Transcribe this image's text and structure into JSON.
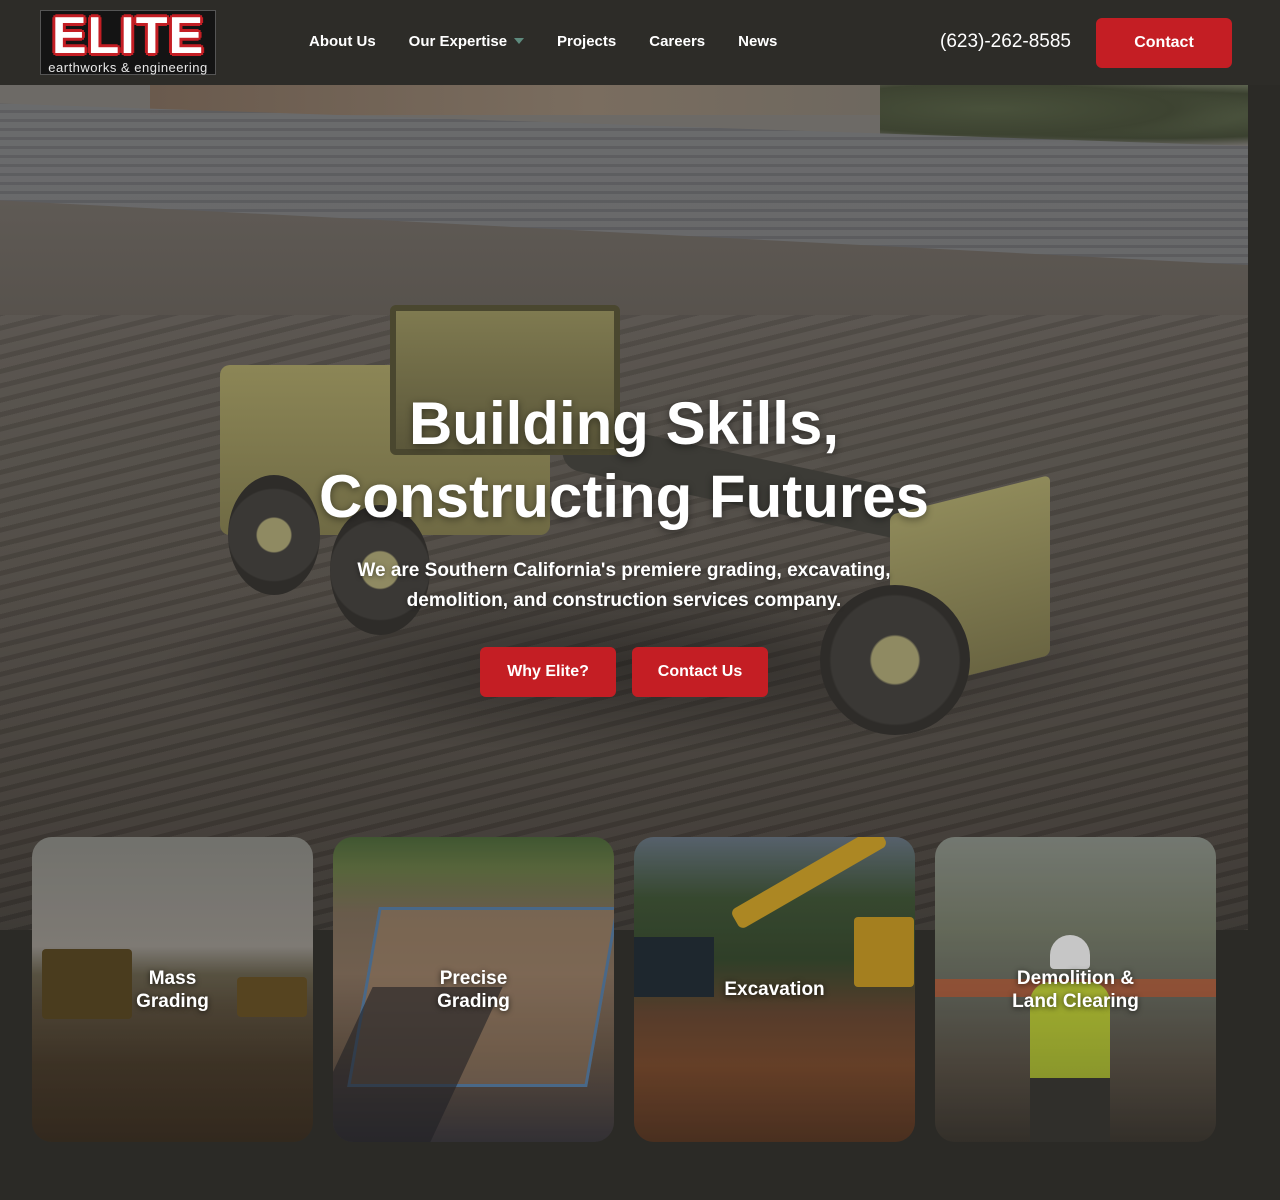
{
  "brand": {
    "logo_text": "ELITE",
    "logo_tagline": "earthworks & engineering",
    "accent_color": "#c41e24"
  },
  "nav": {
    "items": [
      {
        "label": "About Us",
        "has_dropdown": false
      },
      {
        "label": "Our Expertise",
        "has_dropdown": true
      },
      {
        "label": "Projects",
        "has_dropdown": false
      },
      {
        "label": "Careers",
        "has_dropdown": false
      },
      {
        "label": "News",
        "has_dropdown": false
      }
    ],
    "phone": "(623)-262-8585",
    "contact_label": "Contact"
  },
  "hero": {
    "title_line1": "Building Skills,",
    "title_line2": "Constructing Futures",
    "subtitle_line1": "We are Southern California's premiere grading, excavating,",
    "subtitle_line2": "demolition, and construction services company.",
    "why_label": "Why Elite?",
    "contact_us_label": "Contact Us"
  },
  "services": [
    {
      "line1": "Mass",
      "line2": "Grading"
    },
    {
      "line1": "Precise",
      "line2": "Grading"
    },
    {
      "line1": "Excavation",
      "line2": ""
    },
    {
      "line1": "Demolition &",
      "line2": "Land Clearing"
    }
  ]
}
